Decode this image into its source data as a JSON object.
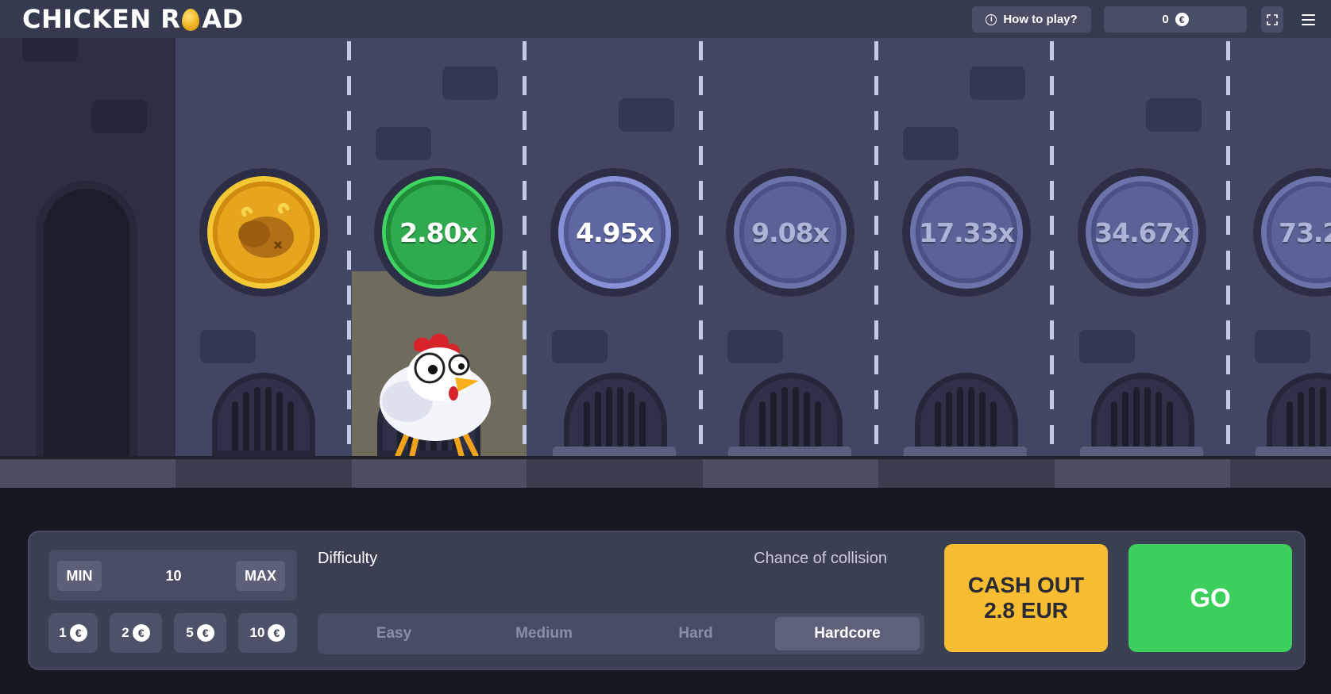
{
  "header": {
    "logo_left": "CHICKEN R",
    "logo_right": "AD",
    "how_to_play": "How to play?",
    "balance_value": "0",
    "currency_symbol": "€"
  },
  "lanes": {
    "multipliers": [
      "2.80x",
      "4.95x",
      "9.08x",
      "17.33x",
      "34.67x",
      "73.2"
    ],
    "active_multiplier": "2.80x"
  },
  "controls": {
    "min_label": "MIN",
    "max_label": "MAX",
    "bet_value": "10",
    "quick_bets": [
      "1",
      "2",
      "5",
      "10"
    ],
    "difficulty_label": "Difficulty",
    "chance_label": "Chance of collision",
    "difficulties": [
      "Easy",
      "Medium",
      "Hard",
      "Hardcore"
    ],
    "selected_difficulty": "Hardcore",
    "cashout_label": "CASH OUT",
    "cashout_amount": "2.8 EUR",
    "go_label": "GO"
  },
  "colors": {
    "accent_green": "#3ccf5e",
    "cashout_yellow": "#f6bc32",
    "scene_bg": "#424663",
    "panel_bg": "#3b3f52"
  }
}
